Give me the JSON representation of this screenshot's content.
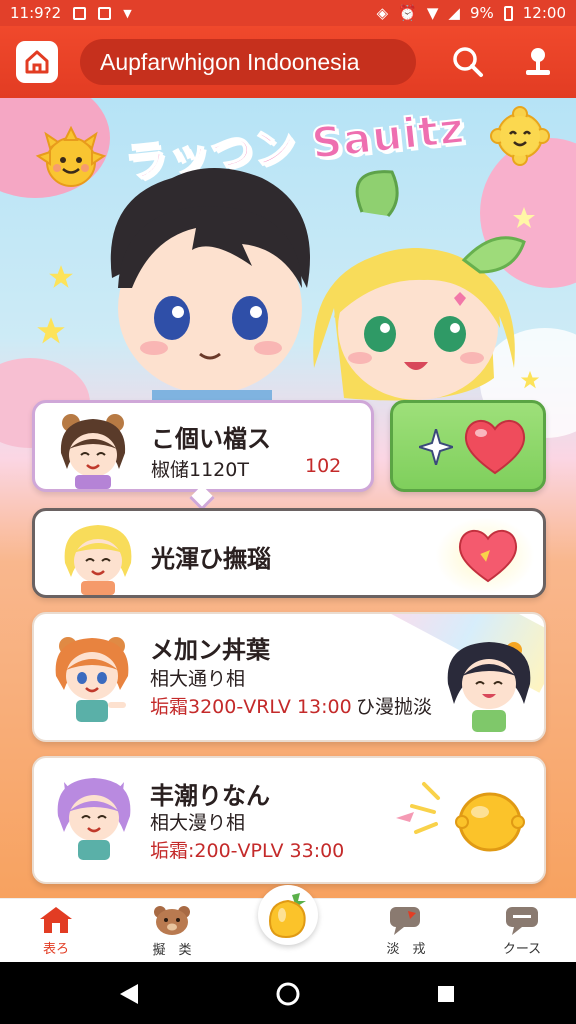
{
  "status_bar": {
    "time_left": "11:9?2",
    "battery": "9%",
    "clock": "12:00"
  },
  "app_bar": {
    "search_text": "Aupfarwhigon Indoonesia",
    "icons": [
      "home-icon",
      "search-icon",
      "profile-icon"
    ]
  },
  "hero": {
    "title": "ラッつン Sauitz"
  },
  "cards": [
    {
      "name": "こ個い檔ス",
      "sub": "椒储1120T",
      "meta": "102"
    },
    {
      "name": "光渾ひ撫瑙"
    },
    {
      "name": "メ加ン丼葉",
      "sub": "相大通り相",
      "meta": "垢霜3200-VRLV 13:00",
      "extra": "ひ漫抛淡"
    },
    {
      "name": "丰潮りなん",
      "sub": "相大漫り相",
      "meta": "垢霜:200-VPLV 33:00"
    }
  ],
  "bottom_nav": [
    {
      "label": "表ろ",
      "icon": "home-icon",
      "active": true
    },
    {
      "label": "擬　类",
      "icon": "bear-icon",
      "active": false
    },
    {
      "label": "",
      "icon": "fruit-icon",
      "active": false
    },
    {
      "label": "淡　戎",
      "icon": "chat-icon",
      "active": false
    },
    {
      "label": "クース",
      "icon": "message-icon",
      "active": false
    }
  ],
  "colors": {
    "accent": "#e23c23",
    "heart": "#ef4c5c",
    "green_button": "#8fd86a",
    "meta_text": "#c42a2a"
  }
}
